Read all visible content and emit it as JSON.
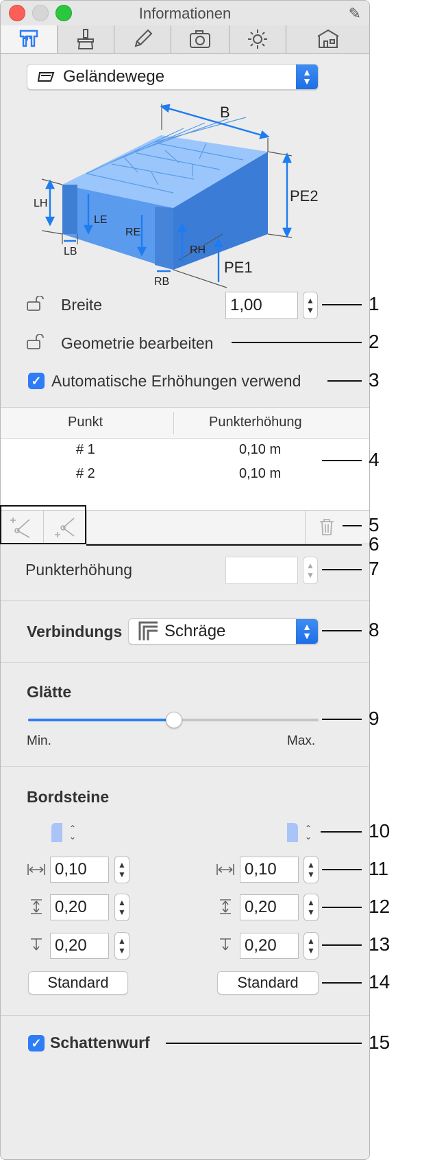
{
  "window": {
    "title": "Informationen"
  },
  "tabs": [
    {
      "icon": "caliper-icon",
      "active": true
    },
    {
      "icon": "brush-icon",
      "active": false
    },
    {
      "icon": "pencil-icon",
      "active": false
    },
    {
      "icon": "camera-icon",
      "active": false
    },
    {
      "icon": "sun-icon",
      "active": false
    },
    {
      "icon": "building-icon",
      "active": false
    }
  ],
  "type_select": {
    "value": "Geländewege",
    "icon": "terrain-path-icon"
  },
  "diagram": {
    "labels": {
      "B": "B",
      "PE2": "PE2",
      "PE1": "PE1",
      "LH": "LH",
      "LE": "LE",
      "RE": "RE",
      "RH": "RH",
      "LB": "LB",
      "RB": "RB"
    }
  },
  "width": {
    "label": "Breite",
    "value": "1,00"
  },
  "geometry": {
    "label": "Geometrie bearbeiten"
  },
  "auto_elevation": {
    "label": "Automatische Erhöhungen verwend",
    "checked": true
  },
  "table": {
    "headers": [
      "Punkt",
      "Punkterhöhung"
    ],
    "rows": [
      {
        "point": "# 1",
        "elevation": "0,10 m"
      },
      {
        "point": "# 2",
        "elevation": "0,10 m"
      }
    ]
  },
  "point_elevation": {
    "label": "Punkterhöhung",
    "value": ""
  },
  "connection": {
    "label": "Verbindungs",
    "value": "Schräge"
  },
  "smoothness": {
    "label": "Glätte",
    "min_label": "Min.",
    "max_label": "Max.",
    "value": 0.5
  },
  "curbs": {
    "label": "Bordsteine",
    "left": {
      "width": "0,10",
      "height": "0,20",
      "depth": "0,20",
      "button": "Standard"
    },
    "right": {
      "width": "0,10",
      "height": "0,20",
      "depth": "0,20",
      "button": "Standard"
    }
  },
  "shadow": {
    "label": "Schattenwurf",
    "checked": true
  },
  "callouts": [
    "1",
    "2",
    "3",
    "4",
    "5",
    "6",
    "7",
    "8",
    "9",
    "10",
    "11",
    "12",
    "13",
    "14",
    "15"
  ],
  "colors": {
    "accent": "#2e7cf6",
    "block_light": "#7fb5f5",
    "block_dark": "#3f7fd3"
  }
}
